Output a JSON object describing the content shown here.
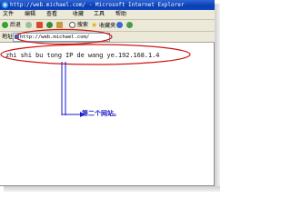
{
  "window": {
    "title": "http://web.michael.com/ - Microsoft Internet Explorer"
  },
  "menu": [
    "文件",
    "编辑",
    "查看",
    "收藏",
    "工具",
    "帮助"
  ],
  "toolbar": {
    "back_label": "后退",
    "search_label": "搜索",
    "favorites_label": "收藏夹"
  },
  "address": {
    "label": "地址",
    "url": "http://web.michael.com/"
  },
  "content": {
    "text": "zhi shi bu tong IP de wang ye.192.168.1.4"
  },
  "annotation": {
    "label": "第二个网站。",
    "color": "#1a1acc",
    "ellipse_color": "#d01818"
  },
  "colors": {
    "titlebar": "#0a3fb0",
    "chrome": "#ece9d8"
  }
}
